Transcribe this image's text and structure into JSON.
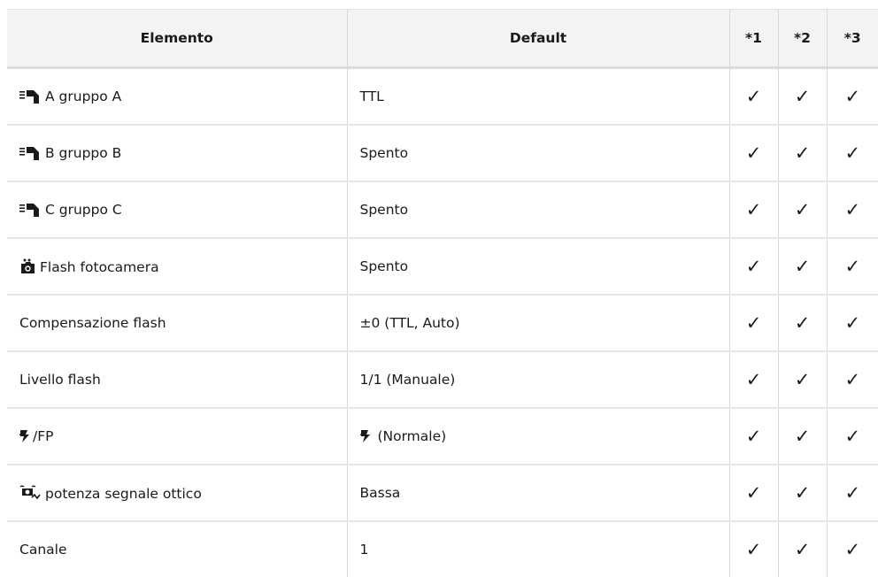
{
  "table": {
    "headers": {
      "item": "Elemento",
      "default": "Default",
      "c1": "*1",
      "c2": "*2",
      "c3": "*3"
    },
    "rows": [
      {
        "icon": "remote-flash-icon",
        "item": "A gruppo A",
        "default": "TTL",
        "c1": "✓",
        "c2": "✓",
        "c3": "✓"
      },
      {
        "icon": "remote-flash-icon",
        "item": "B gruppo B",
        "default": "Spento",
        "c1": "✓",
        "c2": "✓",
        "c3": "✓"
      },
      {
        "icon": "remote-flash-icon",
        "item": "C gruppo C",
        "default": "Spento",
        "c1": "✓",
        "c2": "✓",
        "c3": "✓"
      },
      {
        "icon": "camera-flash-icon",
        "item": "Flash fotocamera",
        "default": "Spento",
        "c1": "✓",
        "c2": "✓",
        "c3": "✓"
      },
      {
        "item": "Compensazione flash",
        "default": "±0 (TTL, Auto)",
        "c1": "✓",
        "c2": "✓",
        "c3": "✓"
      },
      {
        "item": "Livello flash",
        "default": "1/1 (Manuale)",
        "c1": "✓",
        "c2": "✓",
        "c3": "✓"
      },
      {
        "icon": "flash-bolt-icon",
        "item": "/FP",
        "default_icon": "flash-bolt-icon",
        "default": "(Normale)",
        "c1": "✓",
        "c2": "✓",
        "c3": "✓"
      },
      {
        "icon": "optical-signal-icon",
        "item": "potenza segnale ottico",
        "default": "Bassa",
        "c1": "✓",
        "c2": "✓",
        "c3": "✓"
      },
      {
        "item": "Canale",
        "default": "1",
        "c1": "✓",
        "c2": "✓",
        "c3": "✓"
      }
    ]
  }
}
